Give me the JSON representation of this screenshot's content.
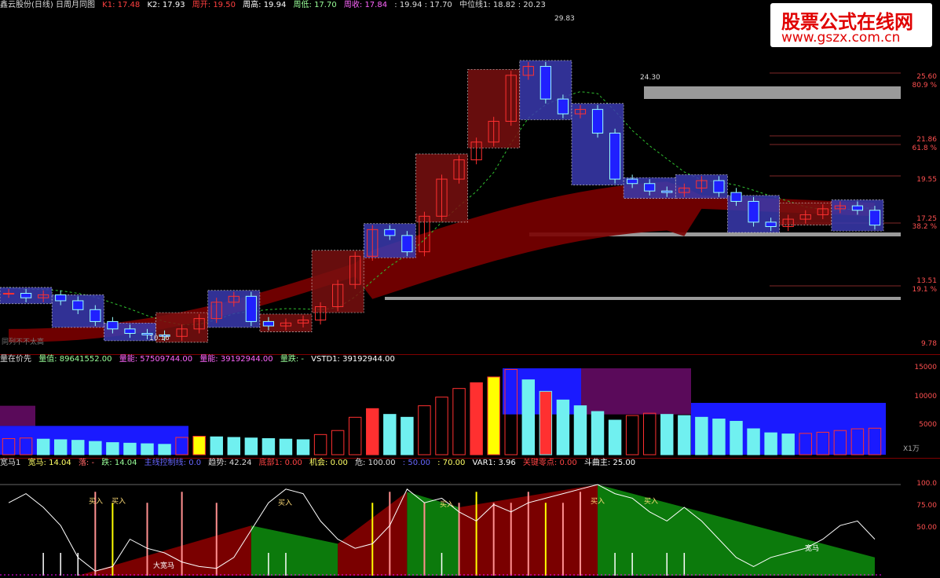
{
  "header": {
    "title": "鑫云股份(日线) 日周月同图",
    "k1": "K1: 17.48",
    "k2": "K2: 17.93",
    "week_open": "周开: 19.50",
    "week_high": "周高: 19.94",
    "week_low": "周低: 17.70",
    "week_close": "周收: 17.84",
    "range": ": 19.94 : 17.70",
    "mid": "中位线1: 18.82 : 20.23"
  },
  "watermark": {
    "line1": "股票公式在线网",
    "line2": "www.gszx.com.cn"
  },
  "main_axis": {
    "labels": [
      "25.60",
      "80.9 %",
      "21.86",
      "61.8 %",
      "19.55",
      "17.25",
      "38.2 %",
      "13.51",
      "19.1 %",
      "9.78"
    ],
    "annotation_high": "29.83",
    "annotation_level": "24.30",
    "annotation_low": "10.16",
    "bottom_left_text": "同列不不太高"
  },
  "volume_header": {
    "title": "量在价先",
    "vol": "量值: 89641552.00",
    "vol_up": "量能: 57509744.00",
    "vol_down": "量能: 39192944.00",
    "vol_flat": "量跌: -",
    "vstd": "VSTD1: 39192944.00"
  },
  "volume_axis": {
    "labels": [
      "15000",
      "10000",
      "5000"
    ],
    "unit": "X1万"
  },
  "osc_header": {
    "a": "宽马1",
    "b": "宽马: 14.04",
    "c": "落: -",
    "d": "跌: 14.04",
    "e": "主线控制线: 0.0",
    "f": "趋势: 42.24",
    "g": "底部1: 0.00",
    "h": "机会: 0.00",
    "i": "危: 100.00",
    "j": ": 50.00",
    "k": ": 70.00",
    "l": "VAR1: 3.96",
    "m": "关键零点: 0.00",
    "n": "斗曲主: 25.00"
  },
  "osc_axis": {
    "labels": [
      "100.0",
      "75.00",
      "50.00"
    ]
  },
  "signals": {
    "buy": "买入",
    "sell": "宽马",
    "start": "大宽马"
  },
  "colors": {
    "up": "#ff3030",
    "down": "#6060ff",
    "cyan": "#70f0f0",
    "yellow": "#ffff00",
    "maroon": "#7a0000",
    "green": "#0c7a0c",
    "purple": "#5a0a5a",
    "grey": "#9a9a9a"
  },
  "chart_data": [
    {
      "type": "line",
      "title": "鑫云股份(日线) 日周月同图",
      "ylim": [
        9.78,
        25.6
      ],
      "series": [
        {
          "name": "close",
          "values": [
            13.3,
            13.0,
            13.2,
            12.8,
            12.2,
            11.4,
            10.9,
            10.6,
            10.5,
            10.4,
            10.9,
            11.6,
            12.7,
            13.1,
            11.4,
            11.1,
            11.3,
            11.5,
            12.4,
            13.9,
            15.8,
            17.6,
            17.2,
            16.1,
            18.5,
            21.0,
            22.3,
            23.5,
            24.9,
            28.0,
            28.6,
            26.4,
            25.4,
            25.7,
            24.1,
            21.0,
            20.7,
            20.2,
            20.1,
            20.4,
            20.9,
            20.1,
            19.5,
            18.1,
            17.8,
            18.3,
            18.6,
            19.0,
            19.2,
            18.9,
            17.9
          ]
        }
      ]
    },
    {
      "type": "bar",
      "title": "量在价先",
      "ylim": [
        0,
        15000
      ],
      "series": [
        {
          "name": "volume",
          "values": [
            2800,
            2900,
            2700,
            2600,
            2500,
            2300,
            2100,
            2000,
            1900,
            1800,
            3000,
            3200,
            3100,
            3000,
            2900,
            2800,
            2700,
            2600,
            3500,
            4200,
            6500,
            8000,
            7000,
            6500,
            8500,
            10000,
            11500,
            12500,
            13500,
            14800,
            13000,
            11000,
            9500,
            8500,
            7500,
            6000,
            6800,
            7200,
            7000,
            6800,
            6500,
            6200,
            5800,
            4500,
            3800,
            3600,
            3700,
            3900,
            4200,
            4500,
            4600
          ]
        }
      ]
    },
    {
      "type": "line",
      "title": "宽马1",
      "ylim": [
        0,
        100
      ],
      "series": [
        {
          "name": "white",
          "values": [
            80,
            90,
            75,
            55,
            20,
            5,
            10,
            40,
            30,
            25,
            15,
            10,
            8,
            20,
            50,
            80,
            95,
            90,
            60,
            40,
            30,
            35,
            55,
            95,
            80,
            85,
            70,
            60,
            78,
            70,
            80,
            85,
            90,
            95,
            100,
            90,
            85,
            70,
            60,
            75,
            60,
            40,
            20,
            10,
            20,
            25,
            30,
            40,
            55,
            60,
            40
          ]
        }
      ]
    }
  ]
}
